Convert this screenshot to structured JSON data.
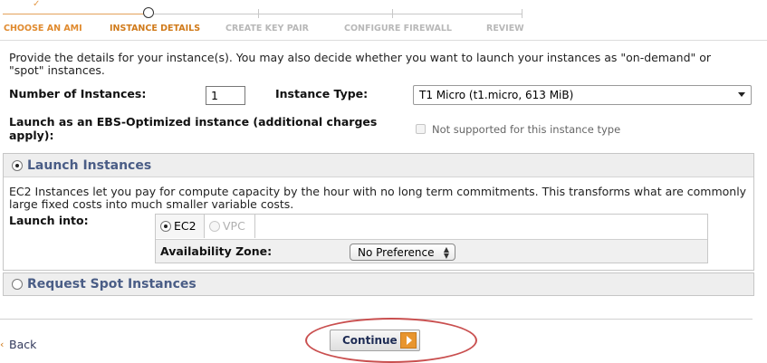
{
  "wizard": {
    "steps": [
      {
        "label": "CHOOSE AN AMI",
        "state": "done"
      },
      {
        "label": "INSTANCE DETAILS",
        "state": "active"
      },
      {
        "label": "CREATE KEY PAIR",
        "state": "future"
      },
      {
        "label": "CONFIGURE FIREWALL",
        "state": "future"
      },
      {
        "label": "REVIEW",
        "state": "future"
      }
    ]
  },
  "intro": "Provide the details for your instance(s). You may also decide whether you want to launch your instances as \"on-demand\" or \"spot\" instances.",
  "form": {
    "num_instances_label": "Number of Instances:",
    "num_instances_value": "1",
    "instance_type_label": "Instance Type:",
    "instance_type_value": "T1 Micro (t1.micro, 613 MiB)",
    "ebs_label": "Launch as an EBS-Optimized instance (additional charges apply):",
    "ebs_checkbox_label": "Not supported for this instance type"
  },
  "launch_panel": {
    "title": "Launch Instances",
    "description": "EC2 Instances let you pay for compute capacity by the hour with no long term commitments. This transforms what are commonly large fixed costs into much smaller variable costs.",
    "launch_into_label": "Launch into:",
    "option_ec2": "EC2",
    "option_vpc": "VPC",
    "az_label": "Availability Zone:",
    "az_value": "No Preference"
  },
  "spot_panel": {
    "title": "Request Spot Instances"
  },
  "footer": {
    "back_label": "Back",
    "continue_label": "Continue"
  },
  "colors": {
    "accent_orange": "#e08a2e",
    "panel_title": "#4a5d86",
    "highlight_oval": "#c94f4f"
  }
}
